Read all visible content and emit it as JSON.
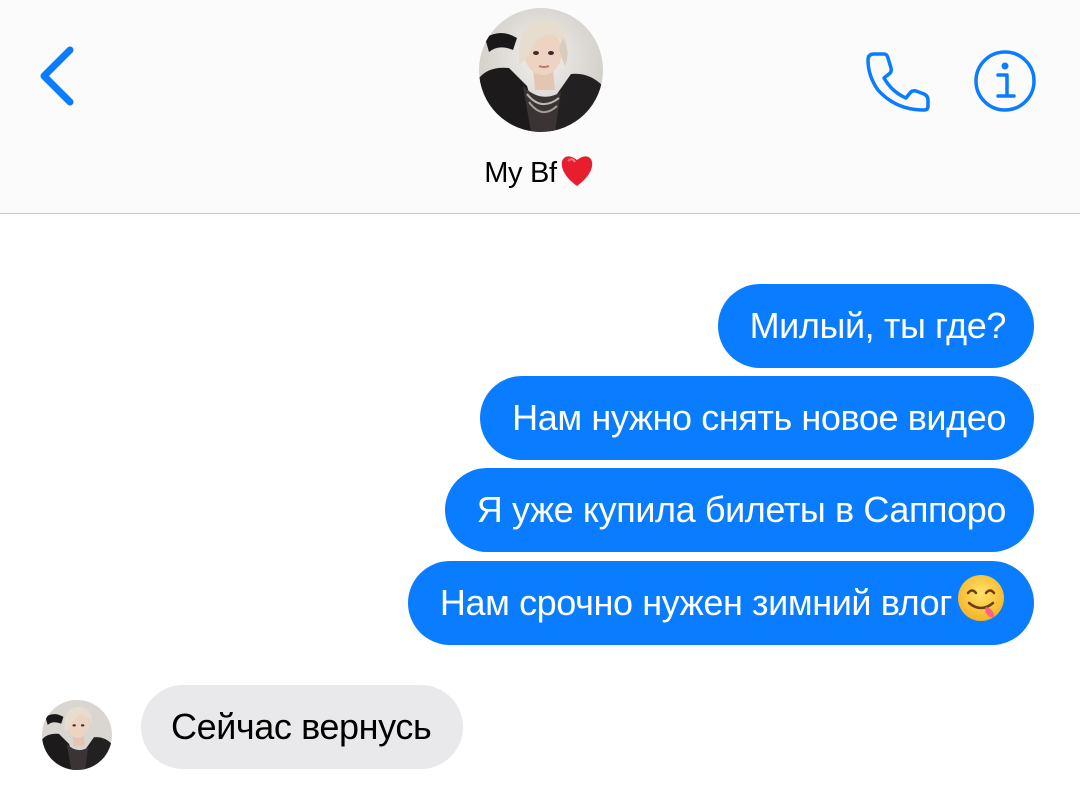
{
  "header": {
    "contact_name": "My Bf",
    "heart_emoji": "❤️",
    "accent_color": "#0a7cff",
    "icons": {
      "back": "chevron-left-icon",
      "call": "phone-icon",
      "info": "info-icon",
      "heart": "red-heart-emoji"
    }
  },
  "messages": [
    {
      "direction": "outgoing",
      "text": "Милый, ты где?"
    },
    {
      "direction": "outgoing",
      "text": "Нам нужно снять новое видео"
    },
    {
      "direction": "outgoing",
      "text": "Я уже купила билеты в Саппоро"
    },
    {
      "direction": "outgoing",
      "text": "Нам срочно нужен зимний влог",
      "emoji": "😋"
    },
    {
      "direction": "incoming",
      "text": "Сейчас вернусь"
    }
  ],
  "colors": {
    "outgoing_bubble": "#0a7cff",
    "incoming_bubble": "#e9e9eb",
    "header_background": "#fbfbfb"
  }
}
